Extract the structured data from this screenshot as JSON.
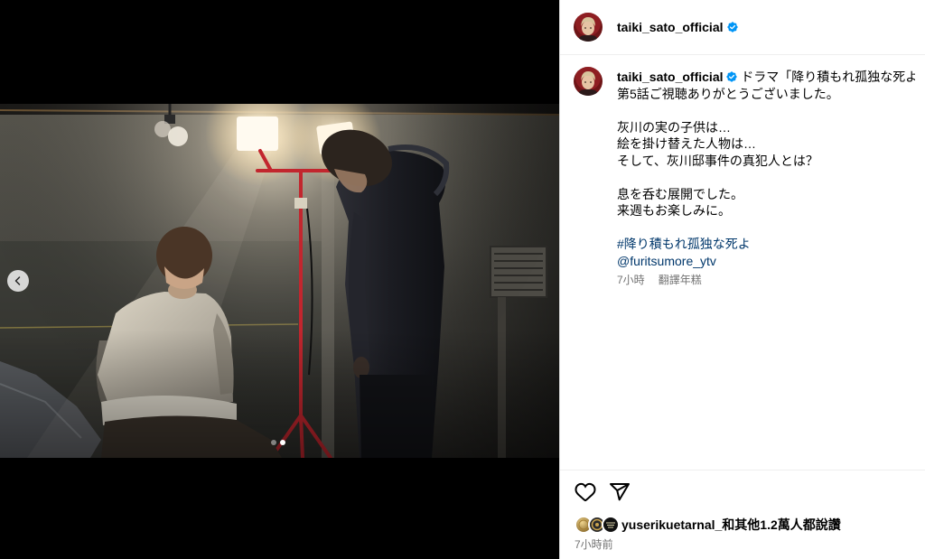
{
  "header": {
    "username": "taiki_sato_official",
    "avatar": "profile-avatar",
    "verified_icon": "verified-badge-icon"
  },
  "media": {
    "slide_count": 2,
    "current_slide": 2,
    "prev_icon": "chevron-left-icon"
  },
  "caption": {
    "username": "taiki_sato_official",
    "paragraphs": [
      [
        "ドラマ「降り積もれ孤独な死よ」",
        "第5話ご視聴ありがとうございました。"
      ],
      [
        "灰川の実の子供は…",
        "絵を掛け替えた人物は…",
        "そして、灰川邸事件の真犯人とは？"
      ],
      [
        "息を呑む展開でした。",
        "来週もお楽しみに。"
      ]
    ],
    "hashtag": "#降り積もれ孤独な死よ",
    "mention": "@furitsumore_ytv",
    "age": "7小時",
    "translate_label": "翻譯年糕"
  },
  "actions": {
    "like_icon": "heart-icon",
    "share_icon": "share-icon"
  },
  "likes": {
    "first_liker": "yuserikuetarnal_",
    "others": "和其他1.2萬人都說讚"
  },
  "timestamp": "7小時前",
  "colors": {
    "link": "#00376b",
    "verified": "#0095f6",
    "secondary_text": "#737373",
    "divider": "#efefef"
  }
}
